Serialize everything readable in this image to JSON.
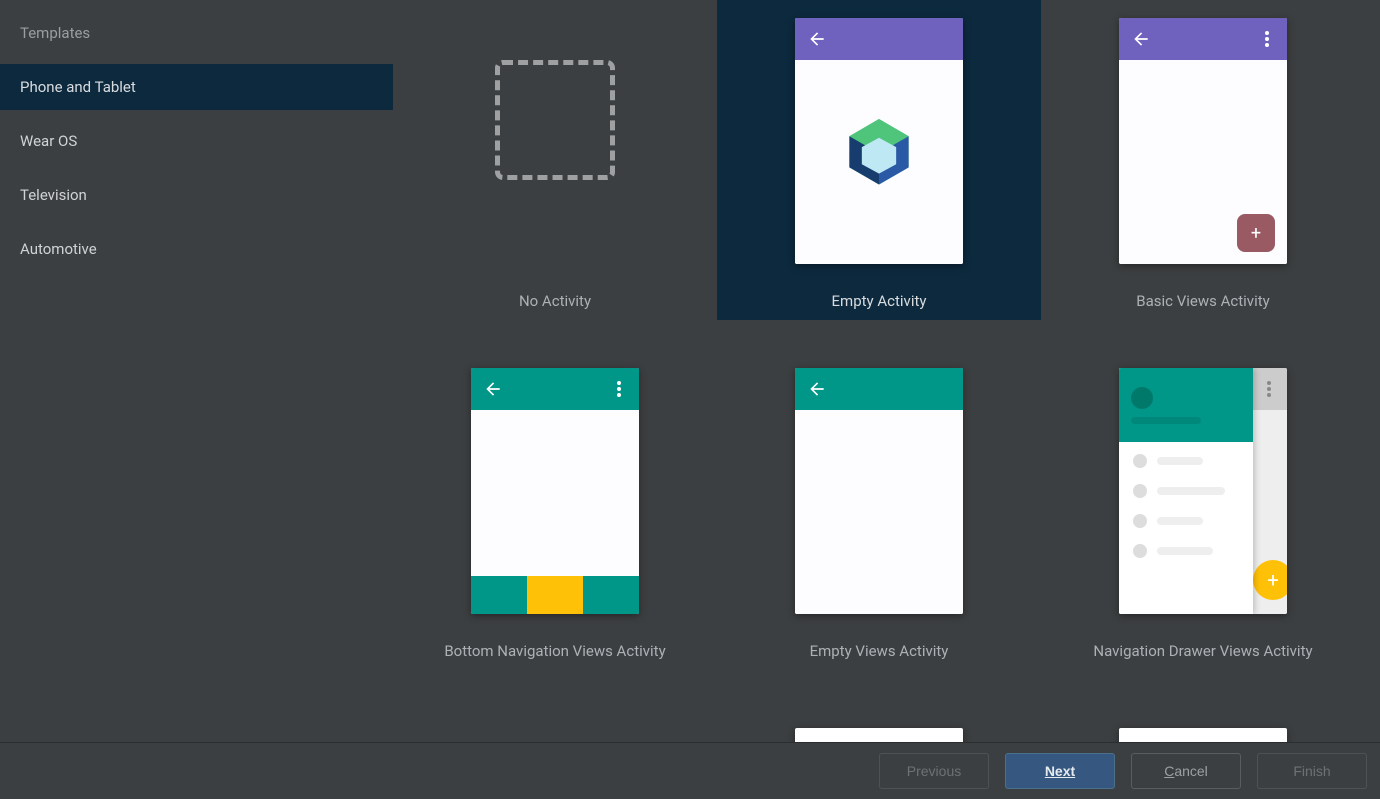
{
  "sidebar": {
    "title": "Templates",
    "items": [
      {
        "label": "Phone and Tablet",
        "selected": true
      },
      {
        "label": "Wear OS",
        "selected": false
      },
      {
        "label": "Television",
        "selected": false
      },
      {
        "label": "Automotive",
        "selected": false
      }
    ]
  },
  "templates": [
    {
      "name": "No Activity",
      "kind": "none",
      "selected": false
    },
    {
      "name": "Empty Activity",
      "kind": "empty-compose",
      "selected": true
    },
    {
      "name": "Basic Views Activity",
      "kind": "basic-views",
      "selected": false
    },
    {
      "name": "Bottom Navigation Views Activity",
      "kind": "bottom-nav",
      "selected": false
    },
    {
      "name": "Empty Views Activity",
      "kind": "empty-views",
      "selected": false
    },
    {
      "name": "Navigation Drawer Views Activity",
      "kind": "nav-drawer",
      "selected": false
    }
  ],
  "footer": {
    "previous": "Previous",
    "next": "Next",
    "cancel": "Cancel",
    "finish": "Finish"
  },
  "colors": {
    "purple": "#6f62be",
    "teal": "#009688",
    "amber": "#ffc107",
    "selection": "#0d293e"
  }
}
